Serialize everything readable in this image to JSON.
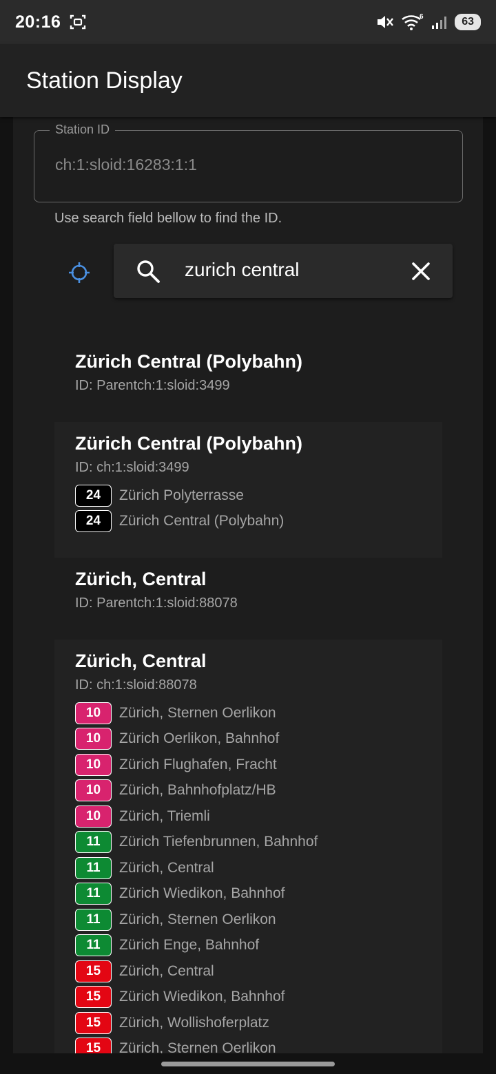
{
  "status_bar": {
    "time": "20:16",
    "battery": "63",
    "icons": [
      "screenshot-icon",
      "mute-icon",
      "wifi-icon",
      "signal-icon",
      "battery-icon"
    ]
  },
  "app_bar": {
    "title": "Station Display"
  },
  "station_field": {
    "label": "Station ID",
    "value": "ch:1:sloid:16283:1:1",
    "helper": "Use search field bellow to find the ID."
  },
  "search": {
    "query": "zurich central",
    "icons": [
      "locate-icon",
      "search-icon",
      "close-icon"
    ]
  },
  "colors": {
    "accent": "#4a90e2",
    "background": "#1d1d1d",
    "card": "#222222"
  },
  "results": [
    {
      "title": "Zürich Central (Polybahn)",
      "id": "ID: Parentch:1:sloid:3499",
      "lines": []
    },
    {
      "title": "Zürich Central (Polybahn)",
      "id": "ID: ch:1:sloid:3499",
      "lines": [
        {
          "number": "24",
          "color": "#000000",
          "stop": "Zürich Polyterrasse"
        },
        {
          "number": "24",
          "color": "#000000",
          "stop": "Zürich Central (Polybahn)"
        }
      ]
    },
    {
      "title": "Zürich, Central",
      "id": "ID: Parentch:1:sloid:88078",
      "lines": []
    },
    {
      "title": "Zürich, Central",
      "id": "ID: ch:1:sloid:88078",
      "lines": [
        {
          "number": "10",
          "color": "#d8236e",
          "stop": "Zürich, Sternen Oerlikon"
        },
        {
          "number": "10",
          "color": "#d8236e",
          "stop": "Zürich Oerlikon, Bahnhof"
        },
        {
          "number": "10",
          "color": "#d8236e",
          "stop": "Zürich Flughafen, Fracht"
        },
        {
          "number": "10",
          "color": "#d8236e",
          "stop": "Zürich, Bahnhofplatz/HB"
        },
        {
          "number": "10",
          "color": "#d8236e",
          "stop": "Zürich, Triemli"
        },
        {
          "number": "11",
          "color": "#0d8a33",
          "stop": "Zürich Tiefenbrunnen, Bahnhof"
        },
        {
          "number": "11",
          "color": "#0d8a33",
          "stop": "Zürich, Central"
        },
        {
          "number": "11",
          "color": "#0d8a33",
          "stop": "Zürich Wiedikon, Bahnhof"
        },
        {
          "number": "11",
          "color": "#0d8a33",
          "stop": "Zürich, Sternen Oerlikon"
        },
        {
          "number": "11",
          "color": "#0d8a33",
          "stop": "Zürich Enge, Bahnhof"
        },
        {
          "number": "15",
          "color": "#e30613",
          "stop": "Zürich, Central"
        },
        {
          "number": "15",
          "color": "#e30613",
          "stop": "Zürich Wiedikon, Bahnhof"
        },
        {
          "number": "15",
          "color": "#e30613",
          "stop": "Zürich, Wollishoferplatz"
        },
        {
          "number": "15",
          "color": "#e30613",
          "stop": "Zürich, Sternen Oerlikon"
        }
      ]
    }
  ]
}
